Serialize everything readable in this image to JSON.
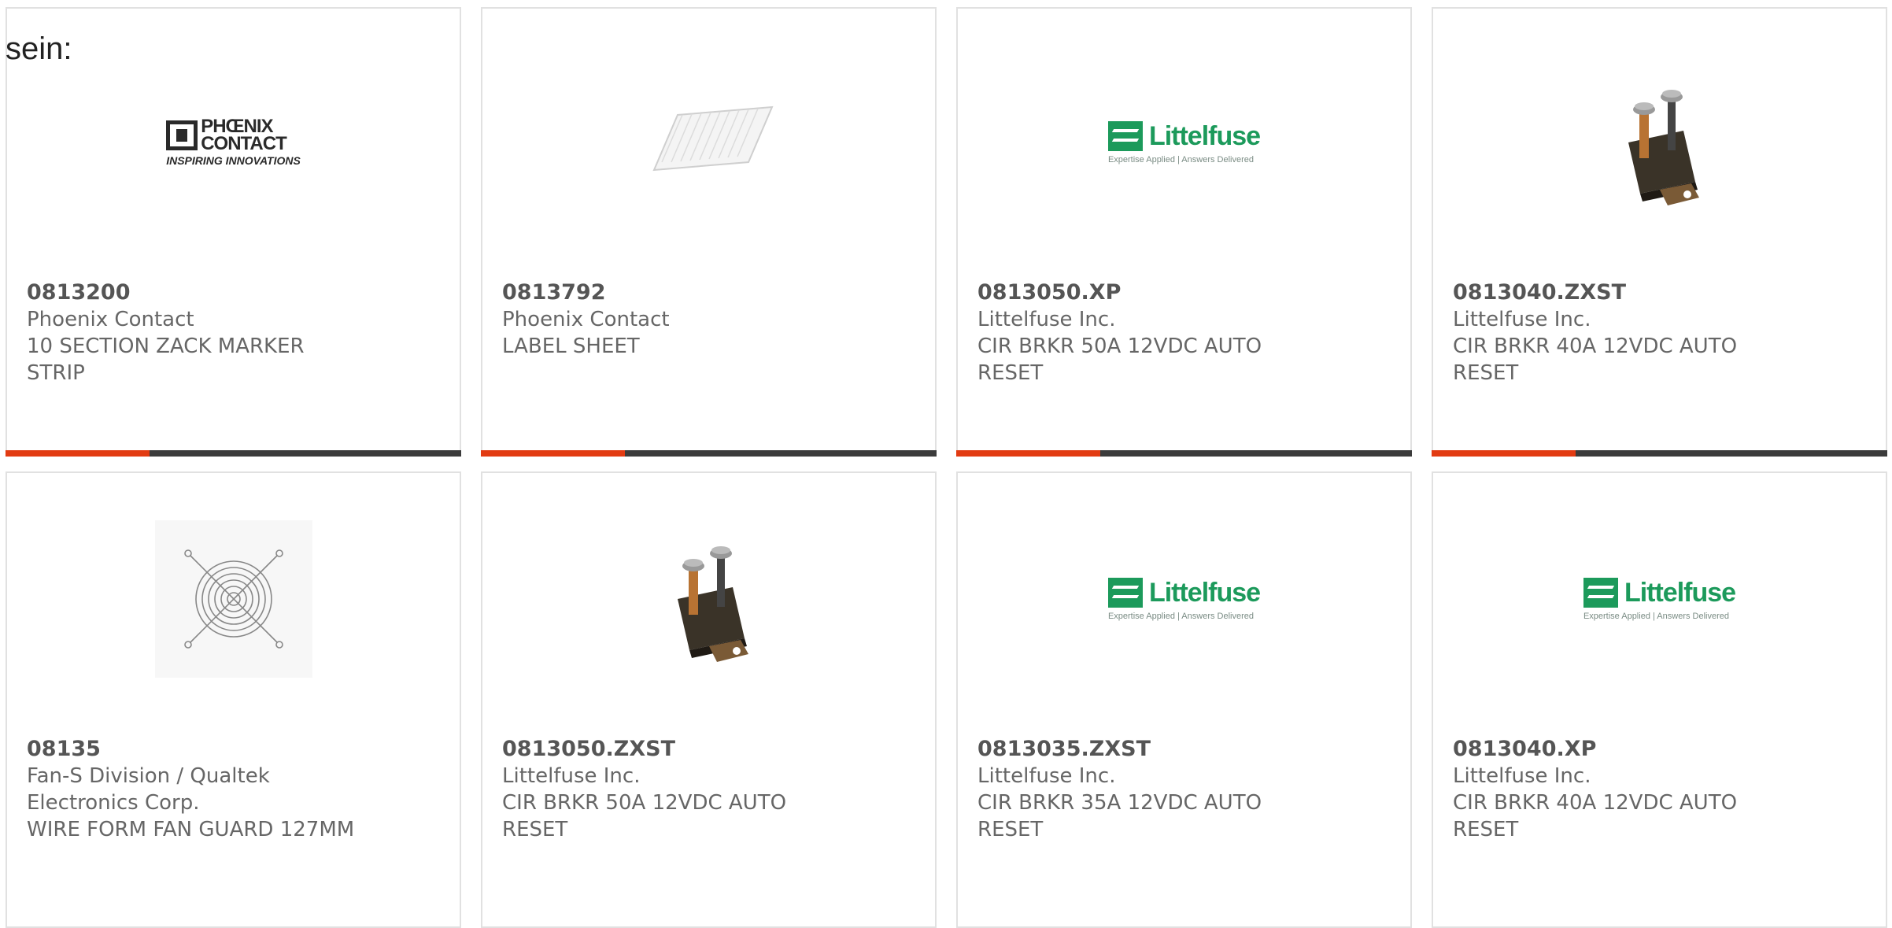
{
  "intro_text": "sein:",
  "products": [
    {
      "part_number": "0813200",
      "manufacturer": "Phoenix Contact",
      "description_line1": "10 SECTION ZACK MARKER",
      "description_line2": "STRIP",
      "image": "phoenix-contact-logo",
      "logo_name_line1": "PHŒNIX",
      "logo_name_line2": "CONTACT",
      "logo_tagline": "INSPIRING INNOVATIONS"
    },
    {
      "part_number": "0813792",
      "manufacturer": "Phoenix Contact",
      "description_line1": "LABEL SHEET",
      "description_line2": "",
      "image": "label-sheet-photo"
    },
    {
      "part_number": "0813050.XP",
      "manufacturer": "Littelfuse Inc.",
      "description_line1": "CIR BRKR 50A 12VDC AUTO",
      "description_line2": "RESET",
      "image": "littelfuse-logo",
      "logo_name": "Littelfuse",
      "logo_tagline": "Expertise Applied | Answers Delivered"
    },
    {
      "part_number": "0813040.ZXST",
      "manufacturer": "Littelfuse Inc.",
      "description_line1": "CIR BRKR 40A 12VDC AUTO",
      "description_line2": "RESET",
      "image": "circuit-breaker-photo"
    },
    {
      "part_number": "08135",
      "manufacturer": "Fan-S Division / Qualtek",
      "manufacturer_line2": "Electronics Corp.",
      "description_line1": "WIRE FORM FAN GUARD 127MM",
      "description_line2": "",
      "image": "fan-guard-photo"
    },
    {
      "part_number": "0813050.ZXST",
      "manufacturer": "Littelfuse Inc.",
      "description_line1": "CIR BRKR 50A 12VDC AUTO",
      "description_line2": "RESET",
      "image": "circuit-breaker-photo"
    },
    {
      "part_number": "0813035.ZXST",
      "manufacturer": "Littelfuse Inc.",
      "description_line1": "CIR BRKR 35A 12VDC AUTO",
      "description_line2": "RESET",
      "image": "littelfuse-logo",
      "logo_name": "Littelfuse",
      "logo_tagline": "Expertise Applied | Answers Delivered"
    },
    {
      "part_number": "0813040.XP",
      "manufacturer": "Littelfuse Inc.",
      "description_line1": "CIR BRKR 40A 12VDC AUTO",
      "description_line2": "RESET",
      "image": "littelfuse-logo",
      "logo_name": "Littelfuse",
      "logo_tagline": "Expertise Applied | Answers Delivered"
    }
  ],
  "colors": {
    "accent": "#e23b12",
    "bar": "#3b3b3b",
    "littelfuse_green": "#1c9a5b"
  }
}
